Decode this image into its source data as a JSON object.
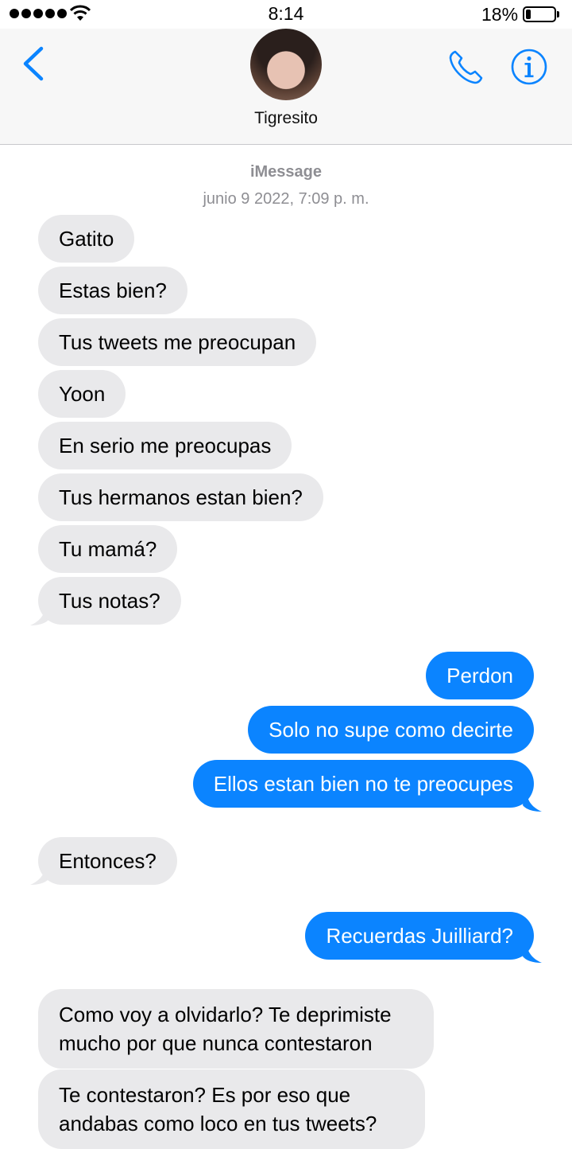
{
  "status": {
    "time": "8:14",
    "battery": "18%",
    "battery_level": 0.18
  },
  "nav": {
    "contact_name": "Tigresito"
  },
  "thread": {
    "service": "iMessage",
    "date": "junio 9 2022, 7:09 p. m.",
    "messages": [
      {
        "from": "them",
        "text": "Gatito"
      },
      {
        "from": "them",
        "text": "Estas bien?"
      },
      {
        "from": "them",
        "text": "Tus tweets me preocupan"
      },
      {
        "from": "them",
        "text": "Yoon"
      },
      {
        "from": "them",
        "text": "En serio me preocupas"
      },
      {
        "from": "them",
        "text": "Tus hermanos estan bien?"
      },
      {
        "from": "them",
        "text": "Tu mamá?"
      },
      {
        "from": "them",
        "text": "Tus notas?"
      },
      {
        "from": "me",
        "text": "Perdon"
      },
      {
        "from": "me",
        "text": "Solo no supe como decirte"
      },
      {
        "from": "me",
        "text": "Ellos estan bien no te preocupes"
      },
      {
        "from": "them",
        "text": "Entonces?"
      },
      {
        "from": "me",
        "text": "Recuerdas Juilliard?"
      },
      {
        "from": "them",
        "text": "Como voy a olvidarlo? Te deprimiste mucho por que nunca contestaron"
      },
      {
        "from": "them",
        "text": "Te contestaron? Es por eso que andabas como loco en tus tweets?"
      }
    ]
  },
  "colors": {
    "accent": "#0b84ff",
    "incoming_bubble": "#e9e9eb",
    "timestamp": "#8e8e93"
  }
}
